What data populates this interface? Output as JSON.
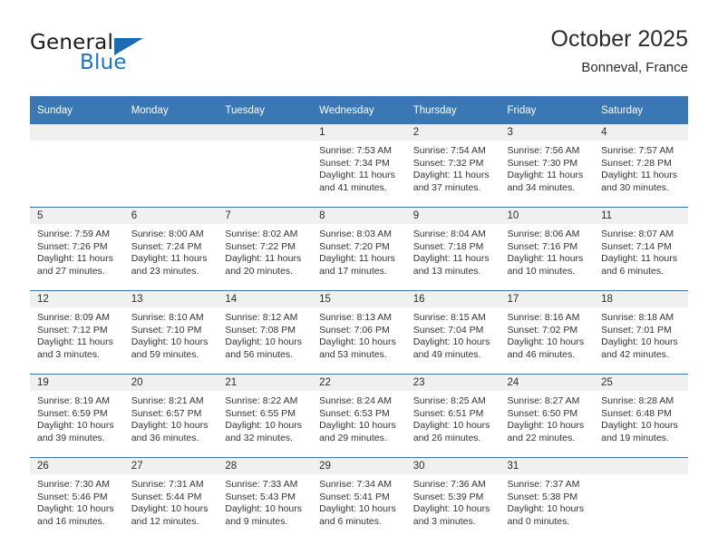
{
  "brand": {
    "name_part1": "General",
    "name_part2": "Blue",
    "triangle_color": "#1b6cb0",
    "blue_color": "#1b75bc"
  },
  "header": {
    "title": "October 2025",
    "subtitle": "Bonneval, France"
  },
  "theme": {
    "header_blue": "#3a77b5",
    "band_gray": "#f0f0f0",
    "text": "#2b2b2b"
  },
  "weekdays": [
    "Sunday",
    "Monday",
    "Tuesday",
    "Wednesday",
    "Thursday",
    "Friday",
    "Saturday"
  ],
  "weeks": [
    [
      {
        "day": "",
        "sunrise": "",
        "sunset": "",
        "daylight1": "",
        "daylight2": ""
      },
      {
        "day": "",
        "sunrise": "",
        "sunset": "",
        "daylight1": "",
        "daylight2": ""
      },
      {
        "day": "",
        "sunrise": "",
        "sunset": "",
        "daylight1": "",
        "daylight2": ""
      },
      {
        "day": "1",
        "sunrise": "Sunrise: 7:53 AM",
        "sunset": "Sunset: 7:34 PM",
        "daylight1": "Daylight: 11 hours",
        "daylight2": "and 41 minutes."
      },
      {
        "day": "2",
        "sunrise": "Sunrise: 7:54 AM",
        "sunset": "Sunset: 7:32 PM",
        "daylight1": "Daylight: 11 hours",
        "daylight2": "and 37 minutes."
      },
      {
        "day": "3",
        "sunrise": "Sunrise: 7:56 AM",
        "sunset": "Sunset: 7:30 PM",
        "daylight1": "Daylight: 11 hours",
        "daylight2": "and 34 minutes."
      },
      {
        "day": "4",
        "sunrise": "Sunrise: 7:57 AM",
        "sunset": "Sunset: 7:28 PM",
        "daylight1": "Daylight: 11 hours",
        "daylight2": "and 30 minutes."
      }
    ],
    [
      {
        "day": "5",
        "sunrise": "Sunrise: 7:59 AM",
        "sunset": "Sunset: 7:26 PM",
        "daylight1": "Daylight: 11 hours",
        "daylight2": "and 27 minutes."
      },
      {
        "day": "6",
        "sunrise": "Sunrise: 8:00 AM",
        "sunset": "Sunset: 7:24 PM",
        "daylight1": "Daylight: 11 hours",
        "daylight2": "and 23 minutes."
      },
      {
        "day": "7",
        "sunrise": "Sunrise: 8:02 AM",
        "sunset": "Sunset: 7:22 PM",
        "daylight1": "Daylight: 11 hours",
        "daylight2": "and 20 minutes."
      },
      {
        "day": "8",
        "sunrise": "Sunrise: 8:03 AM",
        "sunset": "Sunset: 7:20 PM",
        "daylight1": "Daylight: 11 hours",
        "daylight2": "and 17 minutes."
      },
      {
        "day": "9",
        "sunrise": "Sunrise: 8:04 AM",
        "sunset": "Sunset: 7:18 PM",
        "daylight1": "Daylight: 11 hours",
        "daylight2": "and 13 minutes."
      },
      {
        "day": "10",
        "sunrise": "Sunrise: 8:06 AM",
        "sunset": "Sunset: 7:16 PM",
        "daylight1": "Daylight: 11 hours",
        "daylight2": "and 10 minutes."
      },
      {
        "day": "11",
        "sunrise": "Sunrise: 8:07 AM",
        "sunset": "Sunset: 7:14 PM",
        "daylight1": "Daylight: 11 hours",
        "daylight2": "and 6 minutes."
      }
    ],
    [
      {
        "day": "12",
        "sunrise": "Sunrise: 8:09 AM",
        "sunset": "Sunset: 7:12 PM",
        "daylight1": "Daylight: 11 hours",
        "daylight2": "and 3 minutes."
      },
      {
        "day": "13",
        "sunrise": "Sunrise: 8:10 AM",
        "sunset": "Sunset: 7:10 PM",
        "daylight1": "Daylight: 10 hours",
        "daylight2": "and 59 minutes."
      },
      {
        "day": "14",
        "sunrise": "Sunrise: 8:12 AM",
        "sunset": "Sunset: 7:08 PM",
        "daylight1": "Daylight: 10 hours",
        "daylight2": "and 56 minutes."
      },
      {
        "day": "15",
        "sunrise": "Sunrise: 8:13 AM",
        "sunset": "Sunset: 7:06 PM",
        "daylight1": "Daylight: 10 hours",
        "daylight2": "and 53 minutes."
      },
      {
        "day": "16",
        "sunrise": "Sunrise: 8:15 AM",
        "sunset": "Sunset: 7:04 PM",
        "daylight1": "Daylight: 10 hours",
        "daylight2": "and 49 minutes."
      },
      {
        "day": "17",
        "sunrise": "Sunrise: 8:16 AM",
        "sunset": "Sunset: 7:02 PM",
        "daylight1": "Daylight: 10 hours",
        "daylight2": "and 46 minutes."
      },
      {
        "day": "18",
        "sunrise": "Sunrise: 8:18 AM",
        "sunset": "Sunset: 7:01 PM",
        "daylight1": "Daylight: 10 hours",
        "daylight2": "and 42 minutes."
      }
    ],
    [
      {
        "day": "19",
        "sunrise": "Sunrise: 8:19 AM",
        "sunset": "Sunset: 6:59 PM",
        "daylight1": "Daylight: 10 hours",
        "daylight2": "and 39 minutes."
      },
      {
        "day": "20",
        "sunrise": "Sunrise: 8:21 AM",
        "sunset": "Sunset: 6:57 PM",
        "daylight1": "Daylight: 10 hours",
        "daylight2": "and 36 minutes."
      },
      {
        "day": "21",
        "sunrise": "Sunrise: 8:22 AM",
        "sunset": "Sunset: 6:55 PM",
        "daylight1": "Daylight: 10 hours",
        "daylight2": "and 32 minutes."
      },
      {
        "day": "22",
        "sunrise": "Sunrise: 8:24 AM",
        "sunset": "Sunset: 6:53 PM",
        "daylight1": "Daylight: 10 hours",
        "daylight2": "and 29 minutes."
      },
      {
        "day": "23",
        "sunrise": "Sunrise: 8:25 AM",
        "sunset": "Sunset: 6:51 PM",
        "daylight1": "Daylight: 10 hours",
        "daylight2": "and 26 minutes."
      },
      {
        "day": "24",
        "sunrise": "Sunrise: 8:27 AM",
        "sunset": "Sunset: 6:50 PM",
        "daylight1": "Daylight: 10 hours",
        "daylight2": "and 22 minutes."
      },
      {
        "day": "25",
        "sunrise": "Sunrise: 8:28 AM",
        "sunset": "Sunset: 6:48 PM",
        "daylight1": "Daylight: 10 hours",
        "daylight2": "and 19 minutes."
      }
    ],
    [
      {
        "day": "26",
        "sunrise": "Sunrise: 7:30 AM",
        "sunset": "Sunset: 5:46 PM",
        "daylight1": "Daylight: 10 hours",
        "daylight2": "and 16 minutes."
      },
      {
        "day": "27",
        "sunrise": "Sunrise: 7:31 AM",
        "sunset": "Sunset: 5:44 PM",
        "daylight1": "Daylight: 10 hours",
        "daylight2": "and 12 minutes."
      },
      {
        "day": "28",
        "sunrise": "Sunrise: 7:33 AM",
        "sunset": "Sunset: 5:43 PM",
        "daylight1": "Daylight: 10 hours",
        "daylight2": "and 9 minutes."
      },
      {
        "day": "29",
        "sunrise": "Sunrise: 7:34 AM",
        "sunset": "Sunset: 5:41 PM",
        "daylight1": "Daylight: 10 hours",
        "daylight2": "and 6 minutes."
      },
      {
        "day": "30",
        "sunrise": "Sunrise: 7:36 AM",
        "sunset": "Sunset: 5:39 PM",
        "daylight1": "Daylight: 10 hours",
        "daylight2": "and 3 minutes."
      },
      {
        "day": "31",
        "sunrise": "Sunrise: 7:37 AM",
        "sunset": "Sunset: 5:38 PM",
        "daylight1": "Daylight: 10 hours",
        "daylight2": "and 0 minutes."
      },
      {
        "day": "",
        "sunrise": "",
        "sunset": "",
        "daylight1": "",
        "daylight2": ""
      }
    ]
  ]
}
